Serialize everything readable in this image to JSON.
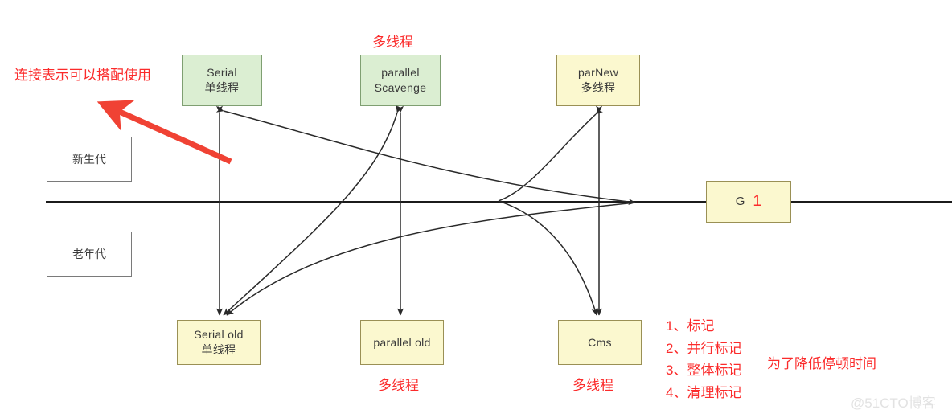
{
  "diagram": {
    "title": "JVM GC Collectors Diagram",
    "colors": {
      "young_gen_box": "#dbeed2",
      "old_gen_box": "#fbf8cf",
      "annotation_red": "#fb2b2b",
      "divider": "#1b1b1b",
      "watermark": "#e2e2e2"
    },
    "generation_labels": [
      {
        "name": "young-generation",
        "text": "新生代"
      },
      {
        "name": "old-generation",
        "text": "老年代"
      }
    ],
    "collectors_top": [
      {
        "id": "serial",
        "line1": "Serial",
        "line2": "单线程",
        "color": "green"
      },
      {
        "id": "parallel-scavenge",
        "line1": "parallel",
        "line2": "Scavenge",
        "color": "green"
      },
      {
        "id": "parnew",
        "line1": "parNew",
        "line2": "多线程",
        "color": "yellow"
      }
    ],
    "collectors_bottom": [
      {
        "id": "serial-old",
        "line1": "Serial old",
        "line2": "单线程",
        "color": "yellow"
      },
      {
        "id": "parallel-old",
        "line1": "parallel old",
        "line2": "",
        "color": "yellow"
      },
      {
        "id": "cms",
        "line1": "Cms",
        "line2": "",
        "color": "yellow"
      }
    ],
    "g1": {
      "label": "G",
      "number": "1"
    },
    "annotations": {
      "arrow_note": "连接表示可以搭配使用",
      "parallel_scavenge_note": "多线程",
      "parallel_old_note": "多线程",
      "cms_note": "多线程",
      "cms_phases": [
        "1、标记",
        "2、并行标记",
        "3、整体标记",
        "4、清理标记"
      ],
      "cms_purpose": "为了降低停顿时间"
    },
    "watermark": "@51CTO博客"
  }
}
